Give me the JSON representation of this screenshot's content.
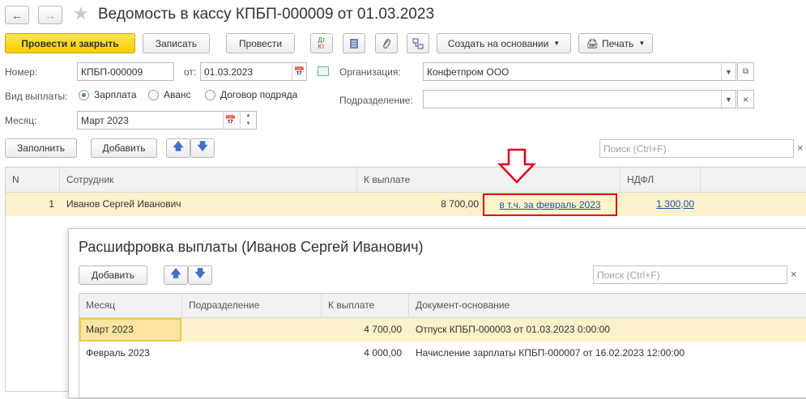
{
  "header": {
    "title": "Ведомость в кассу КПБП-000009 от 01.03.2023",
    "back_icon": "arrow-left-icon",
    "forward_icon": "arrow-right-icon",
    "star_icon": "star-icon"
  },
  "toolbar": {
    "post_close": "Провести и закрыть",
    "save": "Записать",
    "post": "Провести",
    "create_based": "Создать на основании",
    "print": "Печать",
    "dt_kt_line1": "Дт",
    "dt_kt_line2": "Кт"
  },
  "form": {
    "number_label": "Номер:",
    "number_value": "КПБП-000009",
    "date_label": "от:",
    "date_value": "01.03.2023",
    "org_label": "Организация:",
    "org_value": "Конфетпром ООО",
    "paytype_label": "Вид выплаты:",
    "paytype_options": [
      "Зарплата",
      "Аванс",
      "Договор подряда"
    ],
    "paytype_selected": "Зарплата",
    "dept_label": "Подразделение:",
    "dept_value": "",
    "month_label": "Месяц:",
    "month_value": "Март 2023"
  },
  "actions": {
    "fill": "Заполнить",
    "add": "Добавить",
    "search_placeholder": "Поиск (Ctrl+F)",
    "clear": "×"
  },
  "main_table": {
    "columns": [
      "N",
      "Сотрудник",
      "К выплате",
      "НДФЛ"
    ],
    "rows": [
      {
        "n": "1",
        "employee": "Иванов Сергей Иванович",
        "amount": "8 700,00",
        "link": "в т.ч. за февраль 2023",
        "ndfl": "1 300,00"
      }
    ]
  },
  "popup": {
    "title": "Расшифровка выплаты (Иванов Сергей Иванович)",
    "add": "Добавить",
    "search_placeholder": "Поиск (Ctrl+F)",
    "columns": [
      "Месяц",
      "Подразделение",
      "К выплате",
      "Документ-основание"
    ],
    "rows": [
      {
        "month": "Март 2023",
        "dept": "",
        "amount": "4 700,00",
        "doc": "Отпуск КПБП-000003 от 01.03.2023 0:00:00"
      },
      {
        "month": "Февраль 2023",
        "dept": "",
        "amount": "4 000,00",
        "doc": "Начисление зарплаты КПБП-000007 от 16.02.2023 12:00:00"
      }
    ]
  },
  "colors": {
    "accent_yellow": "#f5cc00",
    "selected_row": "#fbf1cb",
    "highlight_red": "#e0001a",
    "link": "#1a4ea8"
  }
}
